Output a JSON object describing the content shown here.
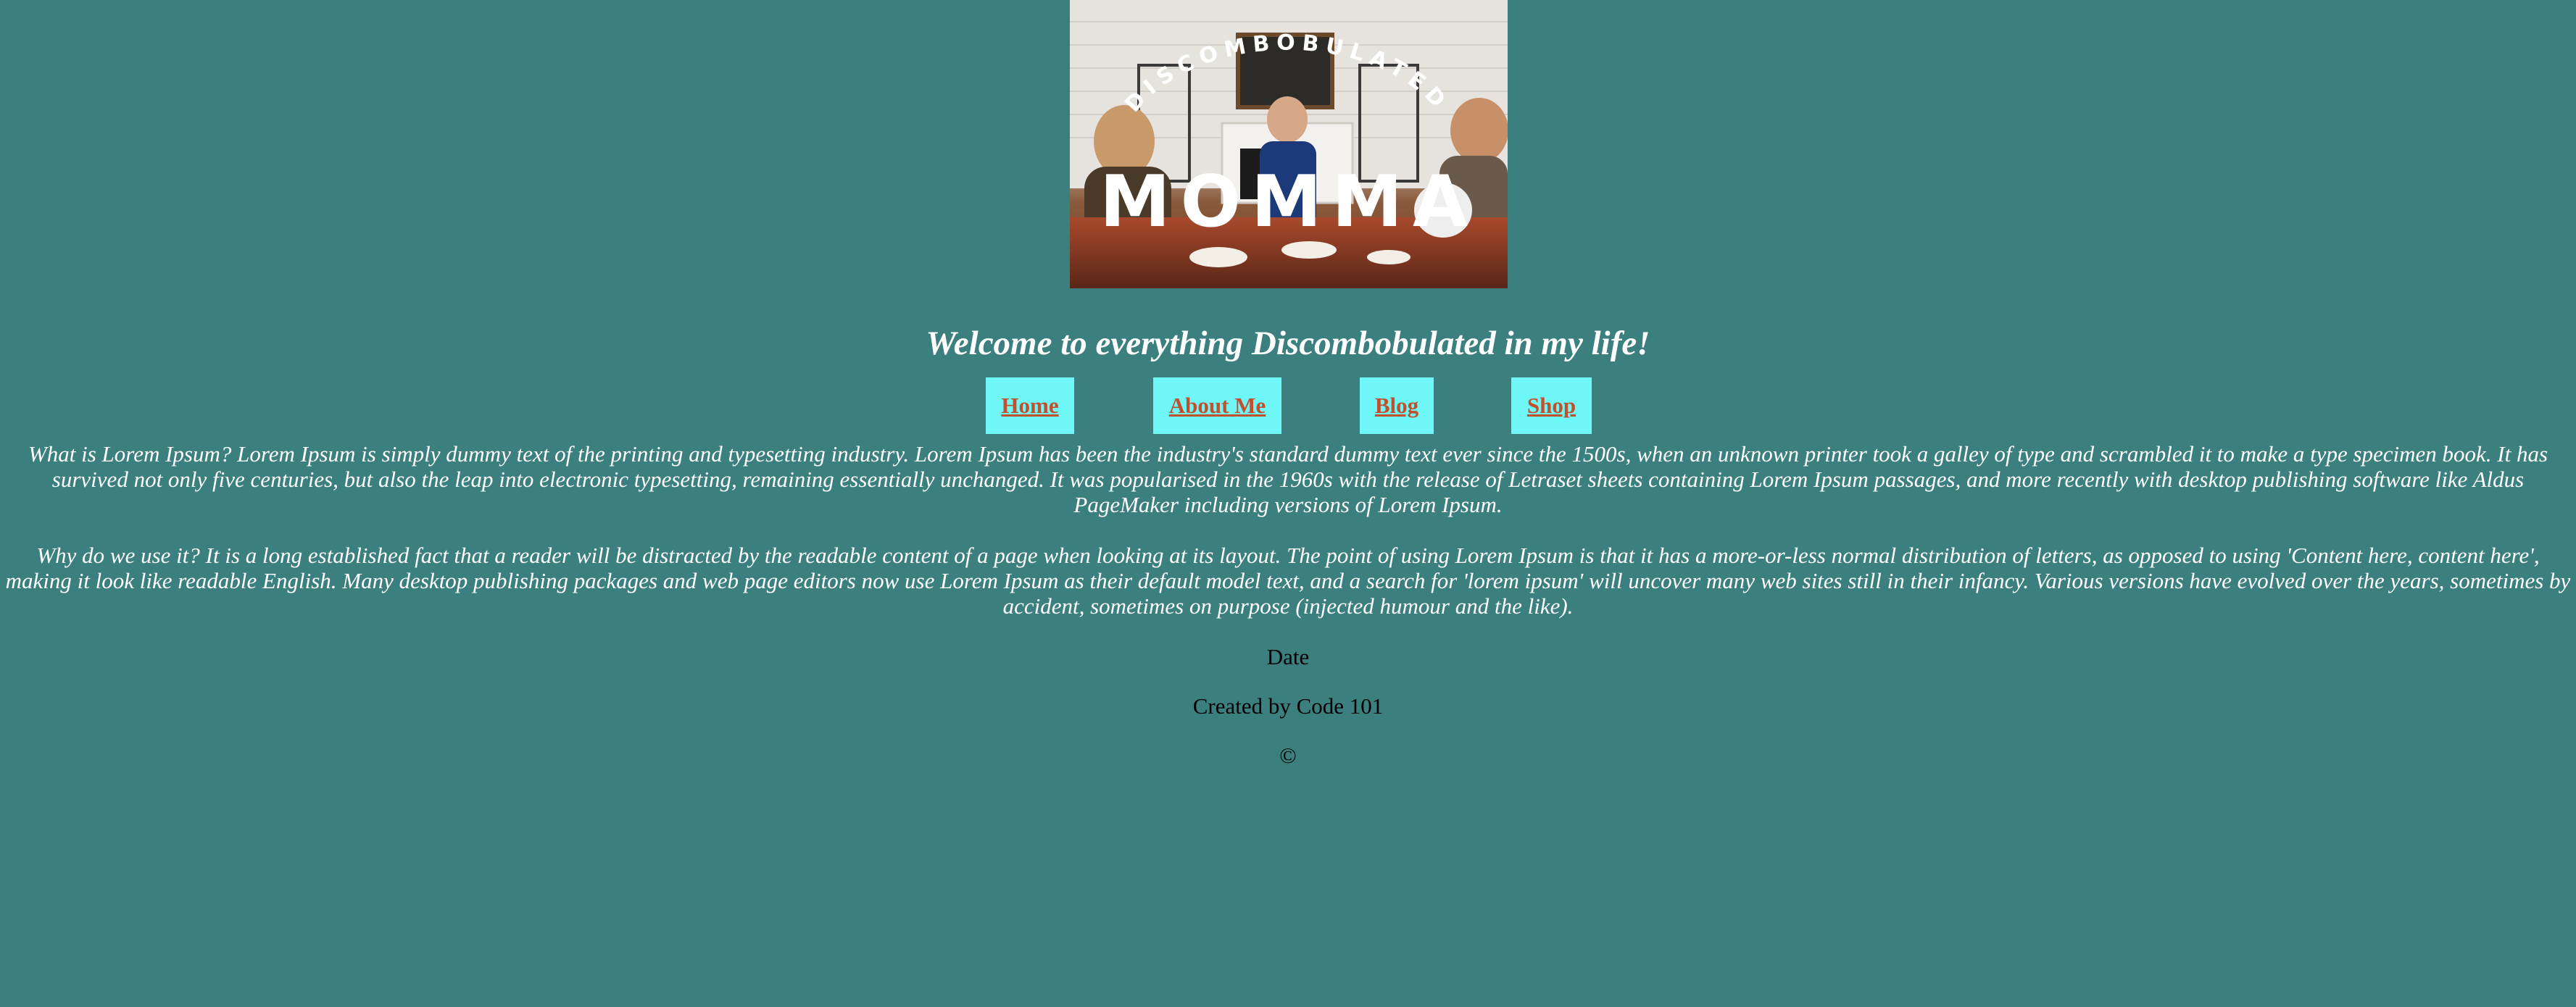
{
  "banner": {
    "arc_text": "DISCOMBOBULATED",
    "big_text": "MOMMA"
  },
  "heading": "Welcome to everything Discombobulated in my life!",
  "nav": [
    {
      "label": "Home"
    },
    {
      "label": "About Me"
    },
    {
      "label": "Blog"
    },
    {
      "label": "Shop"
    }
  ],
  "paragraphs": [
    "What is Lorem Ipsum? Lorem Ipsum is simply dummy text of the printing and typesetting industry. Lorem Ipsum has been the industry's standard dummy text ever since the 1500s, when an unknown printer took a galley of type and scrambled it to make a type specimen book. It has survived not only five centuries, but also the leap into electronic typesetting, remaining essentially unchanged. It was popularised in the 1960s with the release of Letraset sheets containing Lorem Ipsum passages, and more recently with desktop publishing software like Aldus PageMaker including versions of Lorem Ipsum.",
    "Why do we use it? It is a long established fact that a reader will be distracted by the readable content of a page when looking at its layout. The point of using Lorem Ipsum is that it has a more-or-less normal distribution of letters, as opposed to using 'Content here, content here', making it look like readable English. Many desktop publishing packages and web page editors now use Lorem Ipsum as their default model text, and a search for 'lorem ipsum' will uncover many web sites still in their infancy. Various versions have evolved over the years, sometimes by accident, sometimes on purpose (injected humour and the like)."
  ],
  "footer": {
    "date": "Date",
    "created": "Created by Code 101",
    "copyright": "©"
  },
  "colors": {
    "background": "#3b7f7f",
    "nav_bg": "#6ff6f6",
    "nav_link": "#c1502e",
    "text_light": "#ffffff"
  }
}
